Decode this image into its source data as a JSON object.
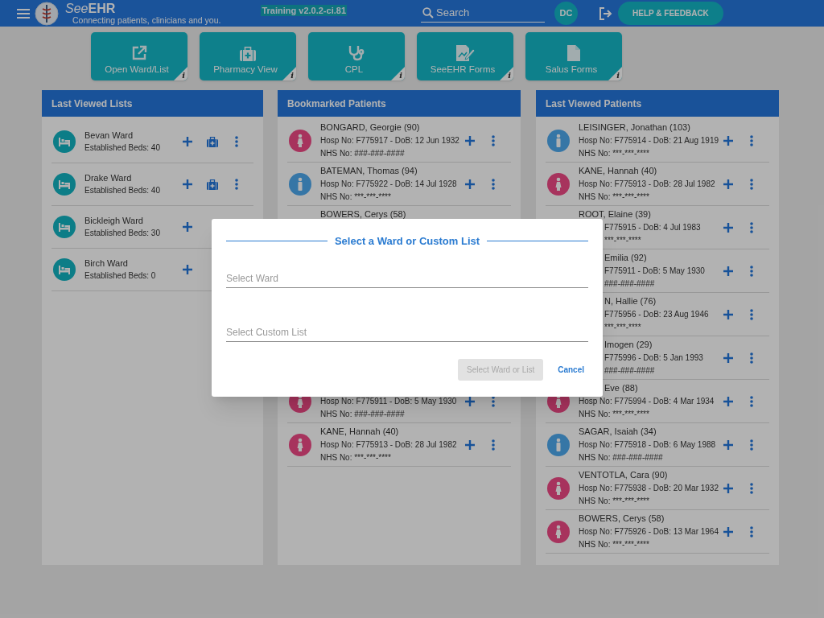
{
  "header": {
    "brand_prefix": "See",
    "brand_suffix": "EHR",
    "tagline": "Connecting patients, clinicians and you.",
    "environment": "Training v2.0.2-ci.81",
    "search": {
      "placeholder": "Search"
    },
    "user_initials": "DC",
    "help_button": "HELP & FEEDBACK"
  },
  "tiles": [
    {
      "kind": "open",
      "label": "Open Ward/List",
      "info": "i"
    },
    {
      "kind": "pharmacy",
      "label": "Pharmacy View",
      "info": "i"
    },
    {
      "kind": "cpl",
      "label": "CPL",
      "info": "i"
    },
    {
      "kind": "forms",
      "label": "SeeEHR Forms",
      "info": "i"
    },
    {
      "kind": "document",
      "label": "Salus Forms",
      "info": "i"
    }
  ],
  "last_viewed_lists": {
    "title": "Last Viewed Lists",
    "items": [
      {
        "name": "Bevan Ward",
        "beds": "Established Beds: 40",
        "pharmacy": true
      },
      {
        "name": "Drake Ward",
        "beds": "Established Beds: 40",
        "pharmacy": true
      },
      {
        "name": "Bickleigh Ward",
        "beds": "Established Beds: 30",
        "pharmacy": false
      },
      {
        "name": "Birch Ward",
        "beds": "Established Beds: 0",
        "pharmacy": false
      }
    ]
  },
  "bookmarked_patients": {
    "title": "Bookmarked Patients",
    "items": [
      {
        "kind": "female",
        "name": "BONGARD, Georgie (90)",
        "hosp": "Hosp No: F775917 - DoB: 12 Jun 1932",
        "nhs": "NHS No: ###-###-####"
      },
      {
        "kind": "male",
        "name": "BATEMAN, Thomas (94)",
        "hosp": "Hosp No: F775922 - DoB: 14 Jul 1928",
        "nhs": "NHS No: ***-***-****"
      },
      {
        "kind": "hidden",
        "name": "BOWERS, Cerys (58)"
      },
      {
        "kind": "female",
        "hosp": "Hosp No: F775911 - DoB: 5 May 1930",
        "nhs": "NHS No: ###-###-####"
      },
      {
        "kind": "female",
        "name": "KANE, Hannah (40)",
        "hosp": "Hosp No: F775913 - DoB: 28 Jul 1982",
        "nhs": "NHS No: ***-***-****"
      }
    ]
  },
  "last_viewed_patients": {
    "title": "Last Viewed Patients",
    "items": [
      {
        "kind": "male",
        "name": "LEISINGER, Jonathan (103)",
        "hosp": "Hosp No: F775914 - DoB: 21 Aug 1919",
        "nhs": "NHS No: ***-***-****",
        "name_clipped": false,
        "hosp_clipped": false,
        "nhs_clipped": false
      },
      {
        "kind": "female",
        "name": "KANE, Hannah (40)",
        "hosp": "Hosp No: F775913 - DoB: 28 Jul 1982",
        "nhs": "NHS No: ***-***-****",
        "name_clipped": false,
        "hosp_clipped": false,
        "nhs_clipped": false
      },
      {
        "kind": "hidden",
        "name": "ROOT, Elaine (39)",
        "hosp": "F775915 - DoB: 4 Jul 1983",
        "nhs": "***-***-****",
        "name_clipped": false,
        "hosp_clipped": true,
        "nhs_clipped": true
      },
      {
        "kind": "hidden",
        "name": "Emilia (92)",
        "hosp": "F775911 - DoB: 5 May 1930",
        "nhs": "###-###-####",
        "name_clipped": true,
        "hosp_clipped": true,
        "nhs_clipped": true
      },
      {
        "kind": "hidden",
        "name": "N, Hallie (76)",
        "hosp": "F775956 - DoB: 23 Aug 1946",
        "nhs": "***-***-****",
        "name_clipped": true,
        "hosp_clipped": true,
        "nhs_clipped": true
      },
      {
        "kind": "hidden",
        "name": "Imogen (29)",
        "hosp": "F775996 - DoB: 5 Jan 1993",
        "nhs": "###-###-####",
        "name_clipped": true,
        "hosp_clipped": true,
        "nhs_clipped": true
      },
      {
        "kind": "female",
        "name": "Eve (88)",
        "hosp": "Hosp No: F775994 - DoB: 4 Mar 1934",
        "nhs": "NHS No: ***-***-****",
        "name_clipped": true,
        "hosp_clipped": false,
        "nhs_clipped": false
      },
      {
        "kind": "male",
        "name": "SAGAR, Isaiah (34)",
        "hosp": "Hosp No: F775918 - DoB: 6 May 1988",
        "nhs": "NHS No: ###-###-####",
        "name_clipped": false,
        "hosp_clipped": false,
        "nhs_clipped": false
      },
      {
        "kind": "female",
        "name": "VENTOTLA, Cara (90)",
        "hosp": "Hosp No: F775938 - DoB: 20 Mar 1932",
        "nhs": "NHS No: ***-***-****",
        "name_clipped": false,
        "hosp_clipped": false,
        "nhs_clipped": false
      },
      {
        "kind": "female",
        "name": "BOWERS, Cerys (58)",
        "hosp": "Hosp No: F775926 - DoB: 13 Mar 1964",
        "nhs": "NHS No: ***-***-****",
        "name_clipped": false,
        "hosp_clipped": false,
        "nhs_clipped": false
      }
    ]
  },
  "dialog": {
    "title": "Select a Ward or Custom List",
    "ward_field": {
      "placeholder": "Select Ward"
    },
    "list_field": {
      "placeholder": "Select Custom List"
    },
    "confirm_button": {
      "label": "Select Ward or List",
      "disabled": true
    },
    "cancel_button": "Cancel"
  }
}
